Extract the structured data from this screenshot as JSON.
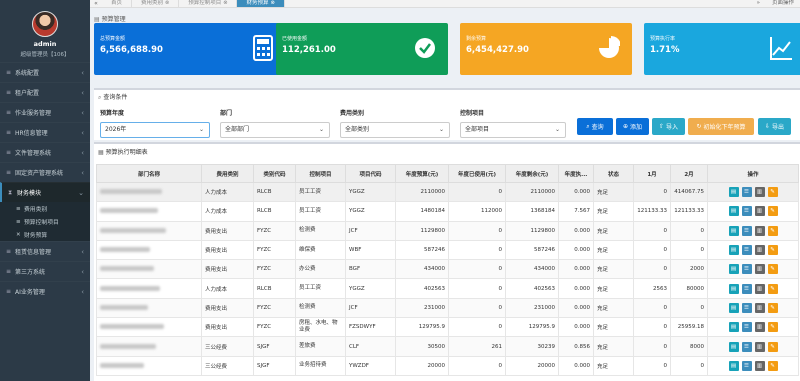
{
  "tabs": [
    "首页",
    "费用类别",
    "预算控制项目",
    "财务预算"
  ],
  "topbar_right": "页面操作",
  "user": {
    "name": "admin",
    "role": "超级管理员【106】"
  },
  "menu": [
    {
      "icon": "≡",
      "label": "系统配置"
    },
    {
      "icon": "≡",
      "label": "租户配置"
    },
    {
      "icon": "≡",
      "label": "作业服务管理"
    },
    {
      "icon": "≡",
      "label": "HR信息管理"
    },
    {
      "icon": "≡",
      "label": "文件管理系统"
    },
    {
      "icon": "≡",
      "label": "固定资产管理系统"
    },
    {
      "icon": "⧗",
      "label": "财务模块"
    },
    {
      "icon": "≡",
      "label": "租赁信息管理"
    },
    {
      "icon": "≡",
      "label": "第三方系统"
    },
    {
      "icon": "≡",
      "label": "AI业务管理"
    }
  ],
  "submenu": [
    {
      "icon": "≡",
      "label": "费用类别"
    },
    {
      "icon": "≡",
      "label": "预算控制项目"
    },
    {
      "icon": "✕",
      "label": "财务预算"
    }
  ],
  "page_title": "预算管理",
  "cards": [
    {
      "label": "总预算金额",
      "value": "6,566,688.90"
    },
    {
      "label": "已使用金额",
      "value": "112,261.00"
    },
    {
      "label": "剩余预算",
      "value": "6,454,427.90"
    },
    {
      "label": "预算执行率",
      "value": "1.71%"
    }
  ],
  "query": {
    "title": "查询条件",
    "year_label": "预算年度",
    "year_value": "2026年",
    "dept_label": "部门",
    "dept_value": "全部部门",
    "type_label": "费用类别",
    "type_value": "全部类别",
    "item_label": "控制项目",
    "item_value": "全部项目",
    "btn_query": "查询",
    "btn_add": "添加",
    "btn_import": "导入",
    "btn_init": "初始化下年预算",
    "btn_export": "导出"
  },
  "table": {
    "title": "预算执行明细表",
    "headers": [
      "部门名称",
      "费用类别",
      "类别代码",
      "控制项目",
      "项目代码",
      "年度预算(元)",
      "年度已使用(元)",
      "年度剩余(元)",
      "年度执...",
      "状态",
      "1月",
      "2月",
      "操作"
    ],
    "rows": [
      [
        "",
        "人力成本",
        "RLCB",
        "员工工资",
        "YGGZ",
        "2110000",
        "0",
        "2110000",
        "0.000",
        "充足",
        "0",
        "414067.75"
      ],
      [
        "",
        "人力成本",
        "RLCB",
        "员工工资",
        "YGGZ",
        "1480184",
        "112000",
        "1368184",
        "7.567",
        "充足",
        "121133.33",
        "121133.33"
      ],
      [
        "",
        "费用支出",
        "FYZC",
        "检测费",
        "JCF",
        "1129800",
        "0",
        "1129800",
        "0.000",
        "充足",
        "0",
        "0"
      ],
      [
        "",
        "费用支出",
        "FYZC",
        "维保费",
        "WBF",
        "587246",
        "0",
        "587246",
        "0.000",
        "充足",
        "0",
        "0"
      ],
      [
        "",
        "费用支出",
        "FYZC",
        "办公费",
        "BGF",
        "434000",
        "0",
        "434000",
        "0.000",
        "充足",
        "0",
        "2000"
      ],
      [
        "",
        "人力成本",
        "RLCB",
        "员工工资",
        "YGGZ",
        "402563",
        "0",
        "402563",
        "0.000",
        "充足",
        "2563",
        "80000"
      ],
      [
        "",
        "费用支出",
        "FYZC",
        "检测费",
        "JCF",
        "231000",
        "0",
        "231000",
        "0.000",
        "充足",
        "0",
        "0"
      ],
      [
        "",
        "费用支出",
        "FYZC",
        "房租、水电、物业费",
        "FZSDWYF",
        "129795.9",
        "0",
        "129795.9",
        "0.000",
        "充足",
        "0",
        "25959.18"
      ],
      [
        "",
        "三公经费",
        "SJGF",
        "差旅费",
        "CLF",
        "30500",
        "261",
        "30239",
        "0.856",
        "充足",
        "0",
        "8000"
      ],
      [
        "",
        "三公经费",
        "SJGF",
        "业务招待费",
        "YWZDF",
        "20000",
        "0",
        "20000",
        "0.000",
        "充足",
        "0",
        "0"
      ]
    ]
  }
}
